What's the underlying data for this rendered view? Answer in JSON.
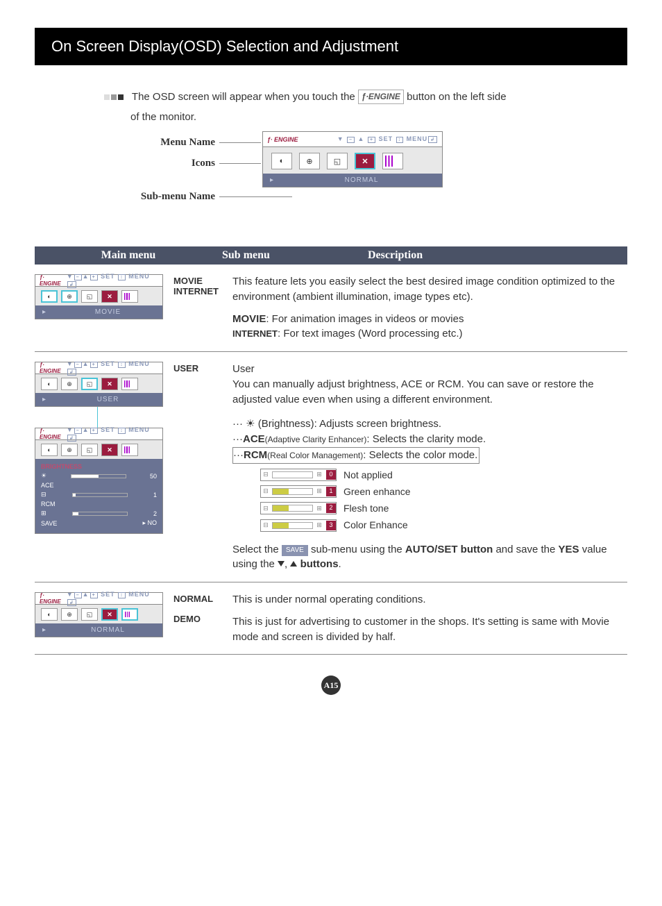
{
  "page": {
    "title": "On Screen Display(OSD) Selection and Adjustment",
    "pageNumber": "A15"
  },
  "intro": {
    "line1_pre": "The OSD screen will appear when you touch the",
    "line1_btn": "ƒ∙ENGINE",
    "line1_post": " button on the  left side",
    "line2": "of the monitor."
  },
  "diagram": {
    "label_menu": "Menu Name",
    "label_icons": "Icons",
    "label_sub": "Sub-menu Name",
    "osd_brand": "ƒ∙ ENGINE",
    "osd_set": "SET",
    "osd_menu": "MENU",
    "footer_normal": "NORMAL"
  },
  "tableHeader": {
    "main": "Main menu",
    "sub": "Sub menu",
    "desc": "Description"
  },
  "movie": {
    "sub1": "MOVIE",
    "sub2": "INTERNET",
    "p1": "This feature lets you easily select the best desired image condition optimized to the environment (ambient illumination, image types etc).",
    "p2a": "MOVIE",
    "p2b": ": For animation images in videos or movies",
    "p3a": "INTERNET",
    "p3b": ": For text images (Word processing etc.)",
    "footer": "MOVIE"
  },
  "user": {
    "sub": "USER",
    "title": "User",
    "p1": "You can manually adjust brightness, ACE or RCM. You can save or restore the adjusted value even when using a different environment.",
    "b1": "(Brightness): Adjusts screen brightness.",
    "ace_b": "ACE",
    "ace_s": "(Adaptive Clarity Enhancer)",
    "ace_t": ": Selects the clarity mode.",
    "rcm_b": "RCM",
    "rcm_s": "(Real Color Management)",
    "rcm_t": ": Selects the color mode.",
    "rcm_items": [
      "Not applied",
      "Green enhance",
      "Flesh tone",
      "Color Enhance"
    ],
    "rcm_nums": [
      "0",
      "1",
      "2",
      "3"
    ],
    "select_pre": "Select the ",
    "save_chip": "SAVE",
    "select_mid": " sub-menu using the ",
    "autoset": "AUTO/SET button",
    "select_save": " and save the ",
    "yes": "YES",
    "select_tail": " value using the ",
    "buttons": "buttons",
    "footer": "USER",
    "bri_label": "BRIGHTNESS",
    "bri_val": "50",
    "ace_label": "ACE",
    "ace_val": "1",
    "rcm_label": "RCM",
    "rcm_val": "2",
    "save_label": "SAVE",
    "no_label": "NO"
  },
  "normal": {
    "sub1": "NORMAL",
    "sub2": "DEMO",
    "p1": "This is under normal operating conditions.",
    "p2": "This is just for advertising to customer in the shops. It's setting is same with Movie mode and screen is divided by half.",
    "footer": "NORMAL"
  }
}
